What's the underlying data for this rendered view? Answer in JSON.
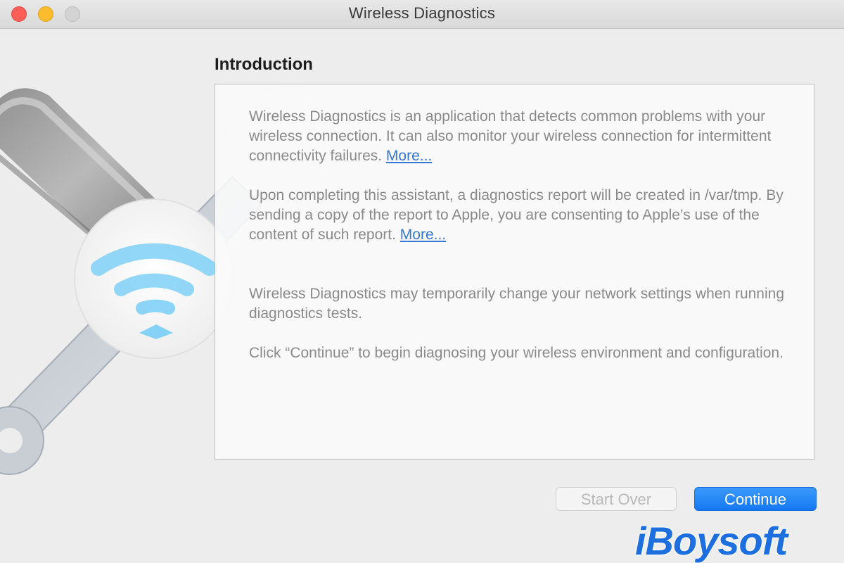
{
  "window": {
    "title": "Wireless Diagnostics"
  },
  "traffic_lights": {
    "close_color": "#fc5f57",
    "minimize_color": "#fdbc2e",
    "zoom_color": "#d3d3d3"
  },
  "section": {
    "title": "Introduction"
  },
  "paragraphs": [
    {
      "text": "Wireless Diagnostics is an application that detects common problems with your wireless connection. It can also monitor your wireless connection for intermittent connectivity failures. ",
      "link": "More..."
    },
    {
      "text": "Upon completing this assistant, a diagnostics report will be created in /var/tmp. By sending a copy of the report to Apple, you are consenting to Apple’s use of the content of such report. ",
      "link": "More..."
    },
    {
      "text": "Wireless Diagnostics may temporarily change your network settings when running diagnostics tests."
    },
    {
      "text": "Click “Continue” to begin diagnosing your wireless environment and configuration."
    }
  ],
  "buttons": {
    "start_over": "Start Over",
    "continue": "Continue"
  },
  "icons": {
    "wifi": "wifi-icon",
    "wrench": "wrench-icon",
    "screwdriver": "screwdriver-icon"
  },
  "colors": {
    "accent": "#1b7bf3",
    "link": "#3477d6",
    "wifi": "#7fd0f7"
  },
  "watermark": {
    "text": "iBoysoft"
  }
}
